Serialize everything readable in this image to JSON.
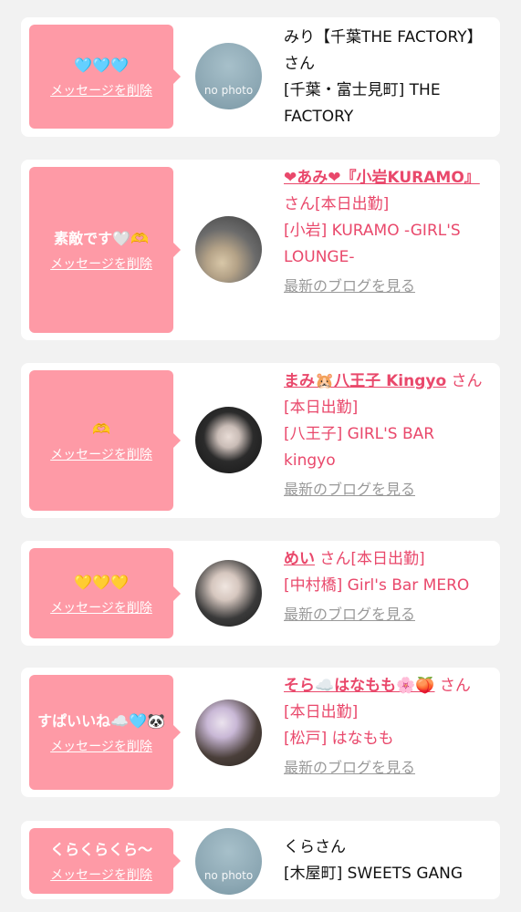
{
  "delete_label": "メッセージを削除",
  "blog_label": "最新のブログを見る",
  "cards": [
    {
      "message": "🩵🩵🩵",
      "avatar": "no photo",
      "name_plain": "みり【千葉THE FACTORY】さん",
      "shop": "[千葉・富士見町] THE FACTORY"
    },
    {
      "message": "素敵です🤍🫶",
      "name": "❤あみ❤『小岩KURAMO』",
      "suffix": "さん[本日出勤]",
      "shop": "[小岩] KURAMO -GIRL'S LOUNGE-"
    },
    {
      "message": "🫶",
      "name": "まみ🐹八王子 Kingyo",
      "suffix": "さん[本日出勤]",
      "shop": "[八王子] GIRL'S BAR kingyo"
    },
    {
      "message": "💛💛💛",
      "name": "めい",
      "suffix": "さん[本日出勤]",
      "shop": "[中村橋] Girl's Bar MERO"
    },
    {
      "message": "すぱいいね☁️🩵🐼",
      "name": "そら☁️はなもも🌸🍑",
      "suffix": "さん[本日出勤]",
      "shop": "[松戸] はなもも"
    },
    {
      "message": "くらくらくら〜",
      "avatar": "no photo",
      "name_plain": "くらさん",
      "shop": "[木屋町] SWEETS GANG"
    }
  ]
}
